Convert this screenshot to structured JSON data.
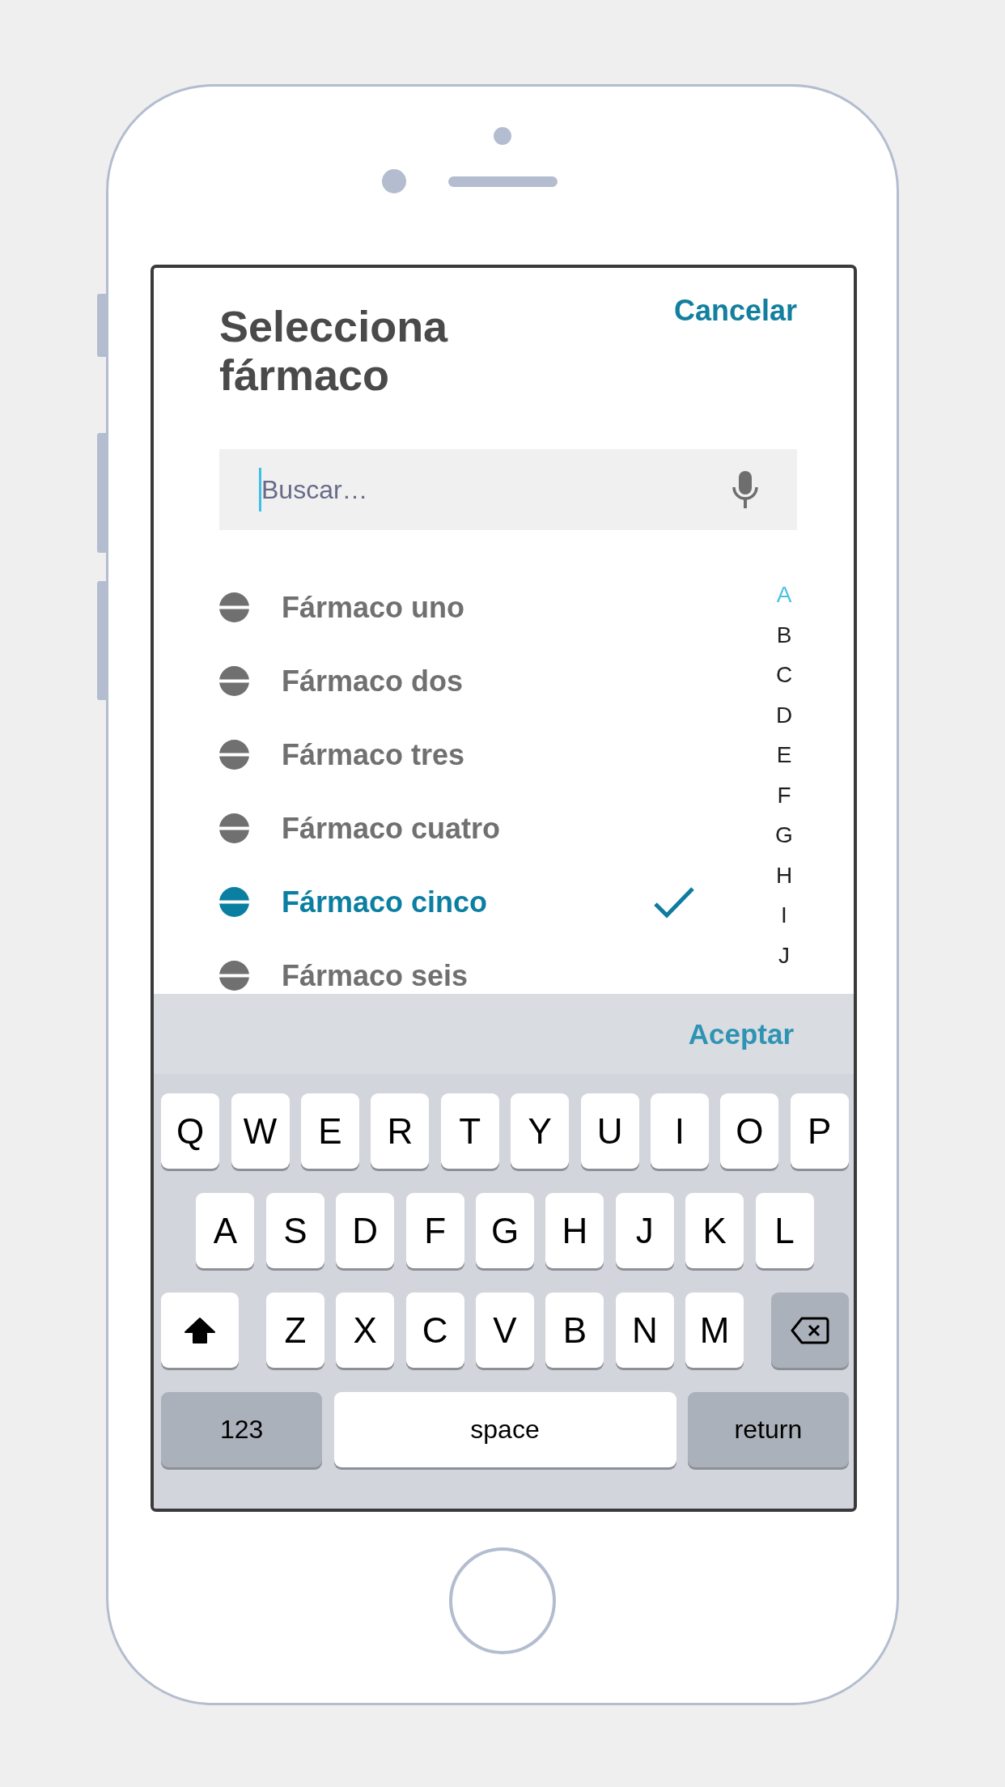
{
  "header": {
    "title": "Selecciona fármaco",
    "cancel": "Cancelar"
  },
  "search": {
    "placeholder": "Buscar…",
    "focused": true
  },
  "drugs": [
    {
      "name": "Fármaco uno",
      "selected": false
    },
    {
      "name": "Fármaco dos",
      "selected": false
    },
    {
      "name": "Fármaco tres",
      "selected": false
    },
    {
      "name": "Fármaco cuatro",
      "selected": false
    },
    {
      "name": "Fármaco cinco",
      "selected": true
    },
    {
      "name": "Fármaco seis",
      "selected": false
    }
  ],
  "index": [
    {
      "letter": "A",
      "selected": true
    },
    {
      "letter": "B",
      "selected": false
    },
    {
      "letter": "C",
      "selected": false
    },
    {
      "letter": "D",
      "selected": false
    },
    {
      "letter": "E",
      "selected": false
    },
    {
      "letter": "F",
      "selected": false
    },
    {
      "letter": "G",
      "selected": false
    },
    {
      "letter": "H",
      "selected": false
    },
    {
      "letter": "I",
      "selected": false
    },
    {
      "letter": "J",
      "selected": false
    }
  ],
  "keyboard": {
    "accept": "Aceptar",
    "rows": [
      {
        "keys": [
          {
            "kind": "letter",
            "label": "Q"
          },
          {
            "kind": "letter",
            "label": "W"
          },
          {
            "kind": "letter",
            "label": "E"
          },
          {
            "kind": "letter",
            "label": "R"
          },
          {
            "kind": "letter",
            "label": "T"
          },
          {
            "kind": "letter",
            "label": "Y"
          },
          {
            "kind": "letter",
            "label": "U"
          },
          {
            "kind": "letter",
            "label": "I"
          },
          {
            "kind": "letter",
            "label": "O"
          },
          {
            "kind": "letter",
            "label": "P"
          }
        ]
      },
      {
        "keys": [
          {
            "kind": "letter",
            "label": "A"
          },
          {
            "kind": "letter",
            "label": "S"
          },
          {
            "kind": "letter",
            "label": "D"
          },
          {
            "kind": "letter",
            "label": "F"
          },
          {
            "kind": "letter",
            "label": "G"
          },
          {
            "kind": "letter",
            "label": "H"
          },
          {
            "kind": "letter",
            "label": "J"
          },
          {
            "kind": "letter",
            "label": "K"
          },
          {
            "kind": "letter",
            "label": "L"
          }
        ]
      },
      {
        "keys": [
          {
            "kind": "shift",
            "on": true
          },
          {
            "kind": "letter",
            "label": "Z"
          },
          {
            "kind": "letter",
            "label": "X"
          },
          {
            "kind": "letter",
            "label": "C"
          },
          {
            "kind": "letter",
            "label": "V"
          },
          {
            "kind": "letter",
            "label": "B"
          },
          {
            "kind": "letter",
            "label": "N"
          },
          {
            "kind": "letter",
            "label": "M"
          },
          {
            "kind": "delete"
          }
        ]
      },
      {
        "keys": [
          {
            "kind": "mode",
            "label": "123"
          },
          {
            "kind": "space",
            "label": "space"
          },
          {
            "kind": "return",
            "label": "return"
          }
        ]
      }
    ]
  }
}
